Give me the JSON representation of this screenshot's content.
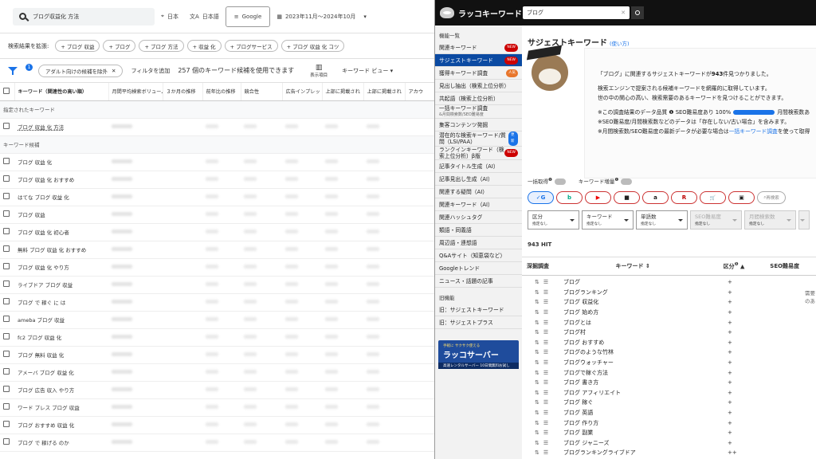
{
  "gkp": {
    "search_value": "ブログ収益化 方法",
    "location": "日本",
    "language": "日本語",
    "network": "Google",
    "date_range": "2023年11月～2024年10月",
    "broaden_label": "検索結果を拡張:",
    "broaden_chips": [
      "+ ブログ 収益",
      "+ ブログ",
      "+ ブログ 方法",
      "+ 収益 化",
      "+ ブログサービス",
      "+ ブログ 収益 化 コツ"
    ],
    "filter_badge": "1",
    "adult_chip": "アダルト向けの候補を除外",
    "add_filter": "フィルタを追加",
    "count_text": "257 個のキーワード候補を使用できます",
    "columns_label": "表示項目",
    "view_label": "キーワード ビュー",
    "headers": [
      "キーワード（関連性の高い順）",
      "月間平均検索ボリューム",
      "３か月の推移",
      "前年比の推移",
      "競合性",
      "広告インプレッ",
      "上部に掲載され",
      "上部に掲載され",
      "アカウ"
    ],
    "section_specified": "指定されたキーワード",
    "specified_keyword": "ブログ 収益 化 方法",
    "section_candidates": "キーワード候補",
    "keywords": [
      "ブログ 収益 化",
      "ブログ 収益 化 おすすめ",
      "はてな ブログ 収益 化",
      "ブログ 収益",
      "ブログ 収益 化 初心者",
      "無料 ブログ 収益 化 おすすめ",
      "ブログ 収益 化 やり方",
      "ライブドア ブログ 収益",
      "ブログ で 稼ぐ に は",
      "ameba ブログ 収益",
      "fc2 ブログ 収益 化",
      "ブログ 無料 収益 化",
      "アメーバ ブログ 収益 化",
      "ブログ 広告 収入 やり方",
      "ワード プレス ブログ 収益",
      "ブログ おすすめ 収益 化",
      "ブログ で 稼げる のか"
    ]
  },
  "rakko": {
    "brand": "ラッコキーワード",
    "search_value": "ブログ",
    "sidebar_section": "機能一覧",
    "sidebar_items": [
      {
        "label": "関連キーワード",
        "sub": "",
        "tag": "NEW",
        "tagtype": "new"
      },
      {
        "label": "サジェストキーワード",
        "sub": "",
        "tag": "NEW",
        "tagtype": "new",
        "active": true
      },
      {
        "label": "獲得キーワード調査",
        "sub": "",
        "tag": "人気",
        "tagtype": "pop"
      },
      {
        "label": "見出し抽出（検索上位分析）",
        "sub": "",
        "tag": "",
        "tagtype": ""
      },
      {
        "label": "共起語（検索上位分析）",
        "sub": "",
        "tag": "",
        "tagtype": ""
      },
      {
        "label": "一括キーワード調査",
        "sub": "&月間検索数/SEO難易度",
        "tag": "",
        "tagtype": ""
      },
      {
        "label": "集客コンテンツ発掘",
        "sub": "",
        "tag": "",
        "tagtype": ""
      },
      {
        "label": "潜在的な検索キーワード/質問（LSI/PAA）",
        "sub": "",
        "tag": "更新",
        "tagtype": "upd"
      },
      {
        "label": "ランクインキーワード（検索上位分析）β版",
        "sub": "",
        "tag": "NEW",
        "tagtype": "new"
      },
      {
        "label": "記事タイトル生成（AI）",
        "sub": "",
        "tag": "",
        "tagtype": ""
      },
      {
        "label": "記事見出し生成（AI）",
        "sub": "",
        "tag": "",
        "tagtype": ""
      },
      {
        "label": "関連する疑問（AI）",
        "sub": "",
        "tag": "",
        "tagtype": ""
      },
      {
        "label": "関連キーワード（AI）",
        "sub": "",
        "tag": "",
        "tagtype": ""
      },
      {
        "label": "関連ハッシュタグ",
        "sub": "",
        "tag": "",
        "tagtype": ""
      },
      {
        "label": "類語・同義語",
        "sub": "",
        "tag": "",
        "tagtype": ""
      },
      {
        "label": "周辺語・連想語",
        "sub": "",
        "tag": "",
        "tagtype": ""
      },
      {
        "label": "Q&Aサイト（知恵袋など）",
        "sub": "",
        "tag": "",
        "tagtype": ""
      },
      {
        "label": "Googleトレンド",
        "sub": "",
        "tag": "",
        "tagtype": ""
      },
      {
        "label": "ニュース・話題の記事",
        "sub": "",
        "tag": "",
        "tagtype": ""
      }
    ],
    "old_section": "旧機能",
    "old_items": [
      "旧：サジェストキーワード",
      "旧：サジェストプラス"
    ],
    "banner": {
      "tag": "手軽に",
      "catch": "サクサク使える",
      "name": "ラッコサーバー",
      "foot": "高速レンタルサーバー 10日間無料お試し"
    },
    "title": "サジェストキーワード",
    "howto": "(使い方)",
    "info": {
      "line1_pre": "「ブログ」に関連するサジェストキーワードが",
      "line1_num": "943",
      "line1_post": "件見つかりました。",
      "line2": "検索エンジンで提案される候補キーワードを網羅的に取得しています。",
      "line3": "世の中の関心の高い、検索需要のあるキーワードを見つけることができます。",
      "line4_pre": "※この調査結果のデータ品質",
      "line4_mid": "SEO難易度あり 100%",
      "line4_post": "月間検索数あ",
      "line5": "※SEO難易度/月間検索数などのデータは「存在しない/古い場合」を含みます。",
      "line6_pre": "※月間検索数/SEO難易度の最新データが必要な場合は",
      "line6_link": "一括キーワード調査",
      "line6_post": "を使って取得",
      "quality_percent": 100
    },
    "toggle_bulk": "一括取得",
    "toggle_amp": "キーワード増量",
    "engines": [
      "G",
      "b",
      "▶",
      "■",
      "a",
      "R",
      "🛒",
      "▣"
    ],
    "research_label": "再検索",
    "selects": [
      {
        "label": "区分",
        "sub": "指定なし",
        "disabled": false
      },
      {
        "label": "キーワード",
        "sub": "指定なし",
        "disabled": false
      },
      {
        "label": "単語数",
        "sub": "指定なし",
        "disabled": false
      },
      {
        "label": "SEO難易度",
        "sub": "指定なし",
        "disabled": true
      },
      {
        "label": "月間検索数",
        "sub": "指定なし",
        "disabled": true
      }
    ],
    "hit": "943 HIT",
    "th_deep": "深掘調査",
    "th_keyword": "キーワード",
    "th_kubun": "区分",
    "th_seo": "SEO難易度",
    "demand": "需要のあ",
    "rows": [
      {
        "k": "ブログ",
        "p": "+"
      },
      {
        "k": "ブログランキング",
        "p": "+"
      },
      {
        "k": "ブログ 収益化",
        "p": "+"
      },
      {
        "k": "ブログ 始め方",
        "p": "+"
      },
      {
        "k": "ブログとは",
        "p": "+"
      },
      {
        "k": "ブログ村",
        "p": "+"
      },
      {
        "k": "ブログ おすすめ",
        "p": "+"
      },
      {
        "k": "ブログのような竹林",
        "p": "+"
      },
      {
        "k": "ブログウォッチャー",
        "p": "+"
      },
      {
        "k": "ブログで稼ぐ方法",
        "p": "+"
      },
      {
        "k": "ブログ 書き方",
        "p": "+"
      },
      {
        "k": "ブログ アフィリエイト",
        "p": "+"
      },
      {
        "k": "ブログ 稼ぐ",
        "p": "+"
      },
      {
        "k": "ブログ 英語",
        "p": "+"
      },
      {
        "k": "ブログ 作り方",
        "p": "+"
      },
      {
        "k": "ブログ 副業",
        "p": "+"
      },
      {
        "k": "ブログ ジャニーズ",
        "p": "+"
      },
      {
        "k": "ブログランキングライブドア",
        "p": "++"
      }
    ]
  }
}
